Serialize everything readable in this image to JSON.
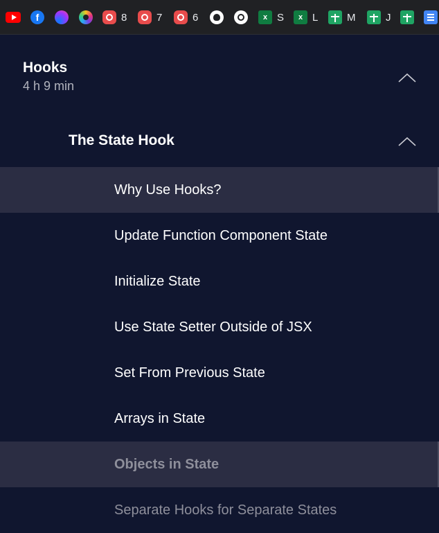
{
  "bookmarks": [
    {
      "icon": "youtube-icon",
      "label": ""
    },
    {
      "icon": "facebook-icon",
      "label": ""
    },
    {
      "icon": "messenger-icon",
      "label": ""
    },
    {
      "icon": "rainbow-app-icon",
      "label": ""
    },
    {
      "icon": "chatgpt-icon",
      "label": "8"
    },
    {
      "icon": "chatgpt-icon",
      "label": "7"
    },
    {
      "icon": "chatgpt-icon",
      "label": "6"
    },
    {
      "icon": "github-icon",
      "label": ""
    },
    {
      "icon": "chatgpt-icon",
      "label": ""
    },
    {
      "icon": "excel-icon",
      "label": "S"
    },
    {
      "icon": "excel-icon",
      "label": "L"
    },
    {
      "icon": "google-sheets-icon",
      "label": "M"
    },
    {
      "icon": "google-sheets-icon",
      "label": "J"
    },
    {
      "icon": "google-sheets-icon",
      "label": ""
    },
    {
      "icon": "google-docs-icon",
      "label": ""
    }
  ],
  "section": {
    "title": "Hooks",
    "duration": "4 h 9 min",
    "expanded": true
  },
  "subsection": {
    "title": "The State Hook",
    "expanded": true
  },
  "lessons": [
    {
      "label": "Why Use Hooks?",
      "state": "hover"
    },
    {
      "label": "Update Function Component State",
      "state": "normal"
    },
    {
      "label": "Initialize State",
      "state": "normal"
    },
    {
      "label": "Use State Setter Outside of JSX",
      "state": "normal"
    },
    {
      "label": "Set From Previous State",
      "state": "normal"
    },
    {
      "label": "Arrays in State",
      "state": "normal"
    },
    {
      "label": "Objects in State",
      "state": "current"
    },
    {
      "label": "Separate Hooks for Separate States",
      "state": "muted"
    }
  ],
  "colors": {
    "background": "#10162f",
    "row_highlight": "#2b2d43",
    "muted_text": "#8e8f9b"
  }
}
